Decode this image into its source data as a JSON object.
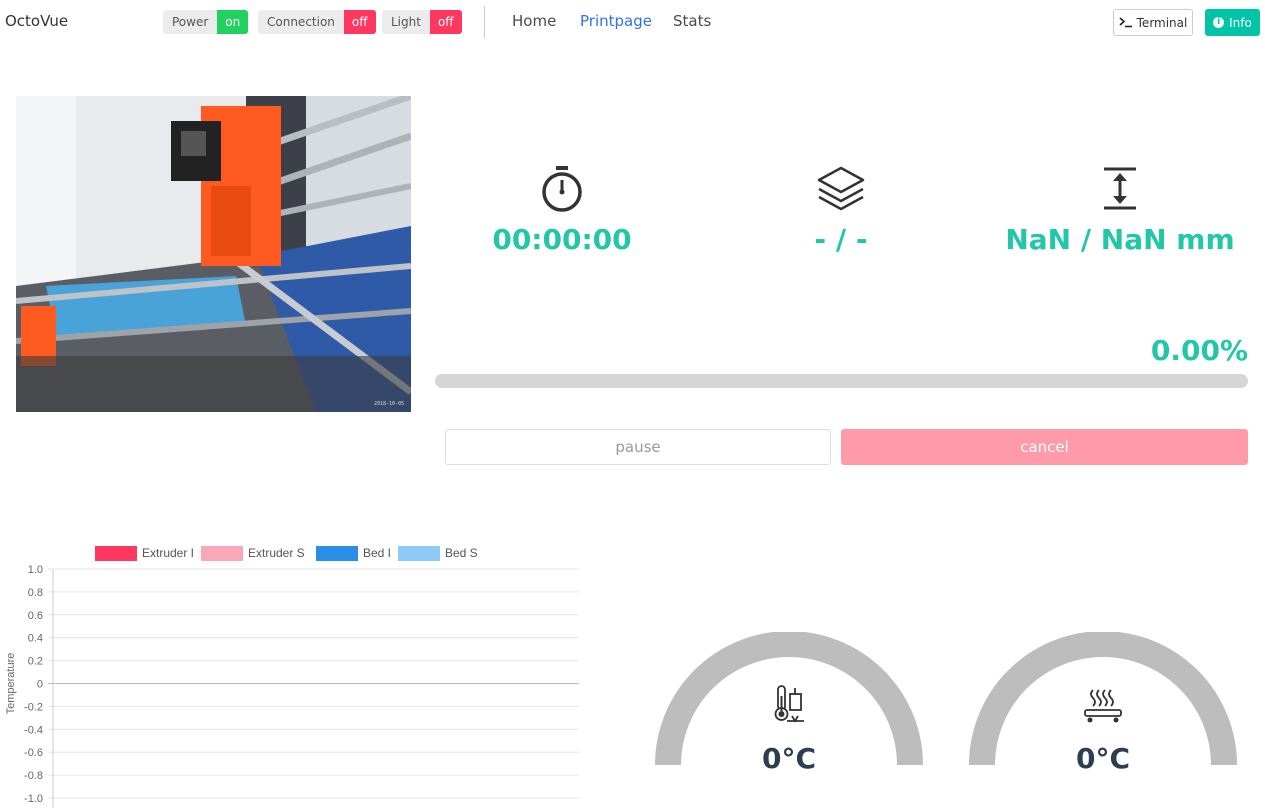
{
  "navbar": {
    "brand": "OctoVue",
    "toggles": [
      {
        "label": "Power",
        "state": "on"
      },
      {
        "label": "Connection",
        "state": "off"
      },
      {
        "label": "Light",
        "state": "off"
      }
    ],
    "links": [
      {
        "label": "Home",
        "active": false
      },
      {
        "label": "Printpage",
        "active": true
      },
      {
        "label": "Stats",
        "active": false
      }
    ],
    "terminal_label": "Terminal",
    "info_label": "Info"
  },
  "stats": {
    "time": "00:00:00",
    "layers": "- / -",
    "height": "NaN / NaN mm",
    "percent": "0.00%",
    "progress_fraction": 0
  },
  "buttons": {
    "pause": "pause",
    "cancel": "cancel"
  },
  "colors": {
    "accent": "#21c7a7",
    "on": "#23d160",
    "off": "#ff3860",
    "link_active": "#3273dc",
    "info": "#00c4a7",
    "cancel": "#ff9aab"
  },
  "chart_data": {
    "type": "line",
    "title": "",
    "xlabel": "",
    "ylabel": "Temperature",
    "ylim": [
      -1.0,
      1.0
    ],
    "yticks": [
      "1.0",
      "0.8",
      "0.6",
      "0.4",
      "0.2",
      "0",
      "-0.2",
      "-0.4",
      "-0.6",
      "-0.8",
      "-1.0"
    ],
    "legend_position": "top",
    "grid": true,
    "series": [
      {
        "name": "Extruder I",
        "color": "#ff3860",
        "values": []
      },
      {
        "name": "Extruder S",
        "color": "#f9a8b8",
        "values": []
      },
      {
        "name": "Bed I",
        "color": "#2a8ee6",
        "values": []
      },
      {
        "name": "Bed S",
        "color": "#8ecbfa",
        "values": []
      }
    ]
  },
  "gauges": [
    {
      "icon": "extruder-thermometer-icon",
      "value": "0°C",
      "fraction": 0
    },
    {
      "icon": "heated-bed-icon",
      "value": "0°C",
      "fraction": 0
    }
  ]
}
